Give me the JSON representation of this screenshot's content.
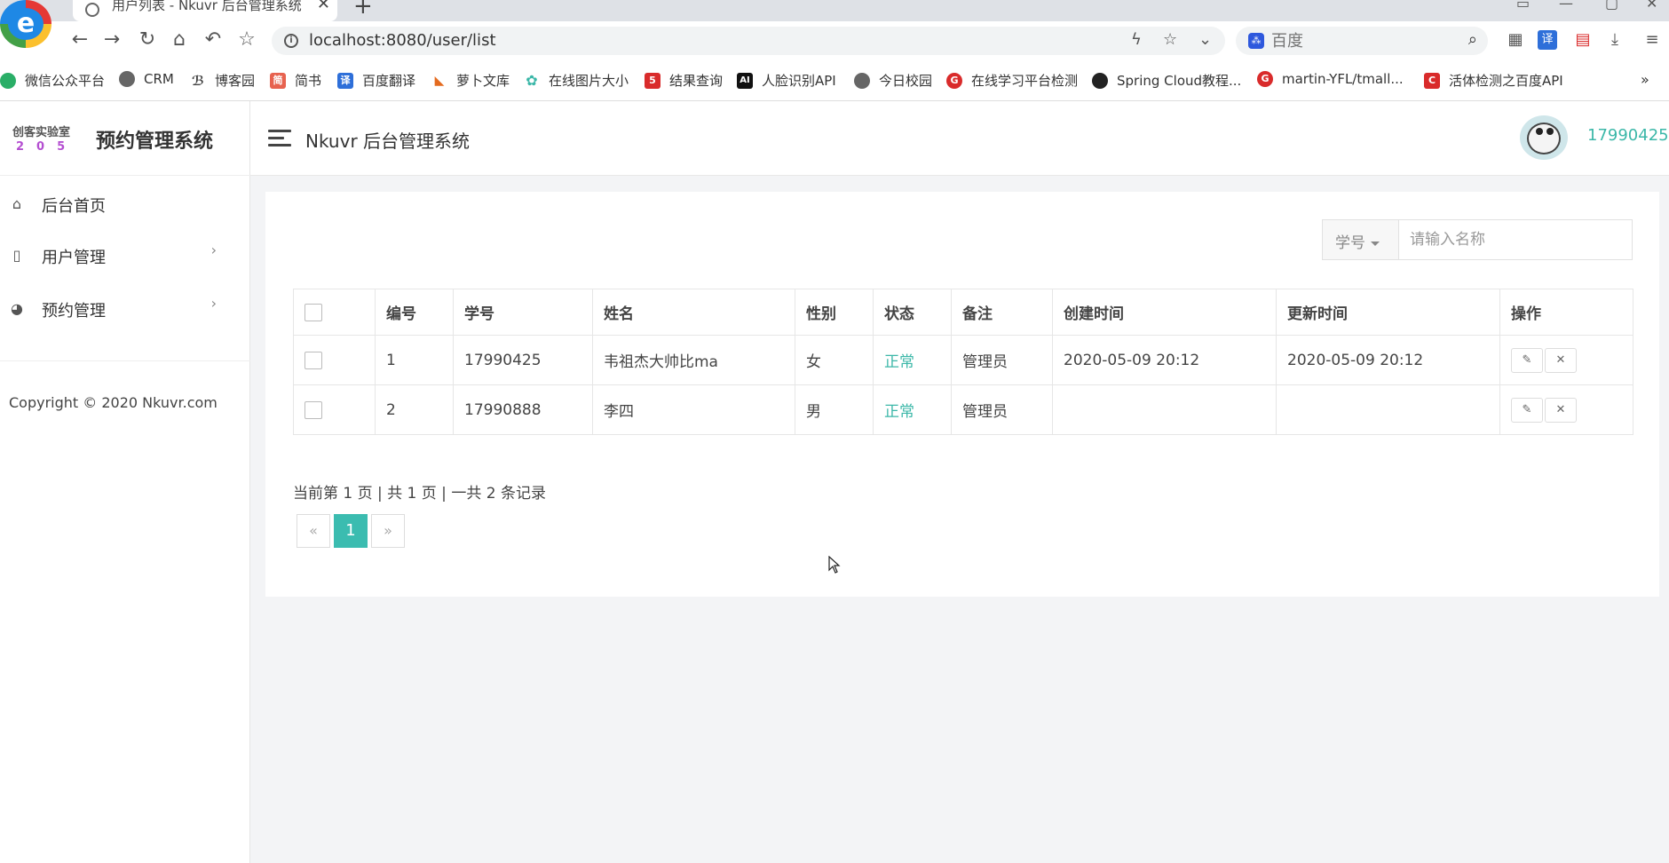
{
  "browser": {
    "tab_title": "用户列表 - Nkuvr 后台管理系统",
    "url": "localhost:8080/user/list",
    "search_placeholder": "百度",
    "bookmarks": [
      {
        "label": "微信公众平台",
        "color": "#2aae67"
      },
      {
        "label": "CRM",
        "color": "#666666"
      },
      {
        "label": "博客园",
        "color": "#444444"
      },
      {
        "label": "简书",
        "color": "#e7624f"
      },
      {
        "label": "百度翻译",
        "color": "#2e6fd9"
      },
      {
        "label": "萝卜文库",
        "color": "#e46b1f"
      },
      {
        "label": "在线图片大小",
        "color": "#3bb7a8"
      },
      {
        "label": "结果查询",
        "color": "#d92b2b"
      },
      {
        "label": "人脸识别API",
        "color": "#111111"
      },
      {
        "label": "今日校园",
        "color": "#666666"
      },
      {
        "label": "在线学习平台检测",
        "color": "#d92b2b"
      },
      {
        "label": "Spring Cloud教程...",
        "color": "#222222"
      },
      {
        "label": "martin-YFL/tmall...",
        "color": "#d92b2b"
      },
      {
        "label": "活体检测之百度API",
        "color": "#d92b2b"
      }
    ],
    "bookmark_icon_text": {
      "translate": "译",
      "jianshu": "简",
      "five": "5",
      "ai": "AI",
      "g": "G",
      "c": "C"
    }
  },
  "sidebar": {
    "logo_line1": "创客实验室",
    "logo_line2": "205",
    "brand_name": "预约管理系统",
    "items": [
      {
        "label": "后台首页",
        "icon": "home-icon"
      },
      {
        "label": "用户管理",
        "icon": "file-icon"
      },
      {
        "label": "预约管理",
        "icon": "palette-icon"
      }
    ],
    "copyright": "Copyright © 2020 Nkuvr.com"
  },
  "header": {
    "title": "Nkuvr 后台管理系统",
    "username": "17990425"
  },
  "filter": {
    "select_value": "学号",
    "placeholder": "请输入名称"
  },
  "table": {
    "columns": [
      "编号",
      "学号",
      "姓名",
      "性别",
      "状态",
      "备注",
      "创建时间",
      "更新时间",
      "操作"
    ],
    "rows": [
      {
        "id": "1",
        "student_no": "17990425",
        "name": "韦祖杰大帅比ma",
        "gender": "女",
        "status": "正常",
        "remark": "管理员",
        "created": "2020-05-09 20:12",
        "updated": "2020-05-09 20:12"
      },
      {
        "id": "2",
        "student_no": "17990888",
        "name": "李四",
        "gender": "男",
        "status": "正常",
        "remark": "管理员",
        "created": "",
        "updated": ""
      }
    ]
  },
  "pagination": {
    "info": "当前第 1 页 | 共 1 页 | 一共 2 条记录",
    "prev": "«",
    "current": "1",
    "next": "»"
  },
  "colors": {
    "accent": "#3bbcb0",
    "status_ok": "#3bb7a8"
  }
}
